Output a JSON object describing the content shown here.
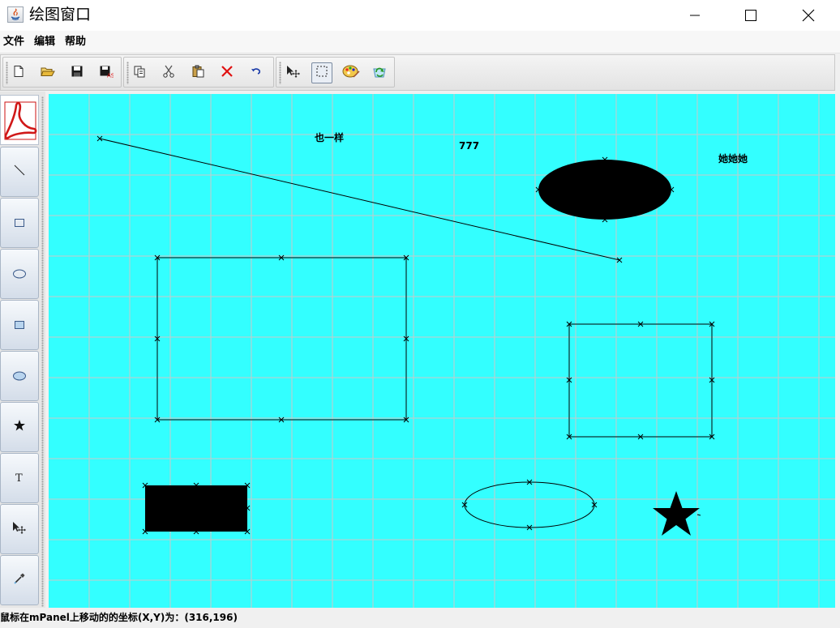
{
  "window": {
    "title": "绘图窗口",
    "controls": [
      "minimize",
      "maximize",
      "close"
    ]
  },
  "menu": [
    "文件",
    "编辑",
    "帮助"
  ],
  "toolbar": {
    "groups": [
      [
        "new-file-icon",
        "open-folder-icon",
        "save-icon",
        "save-as-icon"
      ],
      [
        "copy-icon",
        "cut-icon",
        "paste-icon",
        "delete-icon",
        "undo-icon"
      ],
      [
        "move-select-icon",
        "rect-select-icon",
        "palette-icon",
        "refresh-icon"
      ]
    ],
    "selected": "rect-select-icon"
  },
  "tools": [
    "pdf-icon",
    "line-tool",
    "rectangle-tool",
    "ellipse-tool",
    "filled-rectangle-tool",
    "filled-ellipse-tool",
    "star-tool",
    "text-tool",
    "move-tool",
    "eyedropper-tool"
  ],
  "canvas": {
    "background": "#33ffff",
    "grid_color": "#c8c8c8",
    "texts": [
      "也一样",
      "777",
      "她她她"
    ]
  },
  "status": {
    "text": "鼠标在mPanel上移动的的坐标(X,Y)为：(316,196)"
  }
}
